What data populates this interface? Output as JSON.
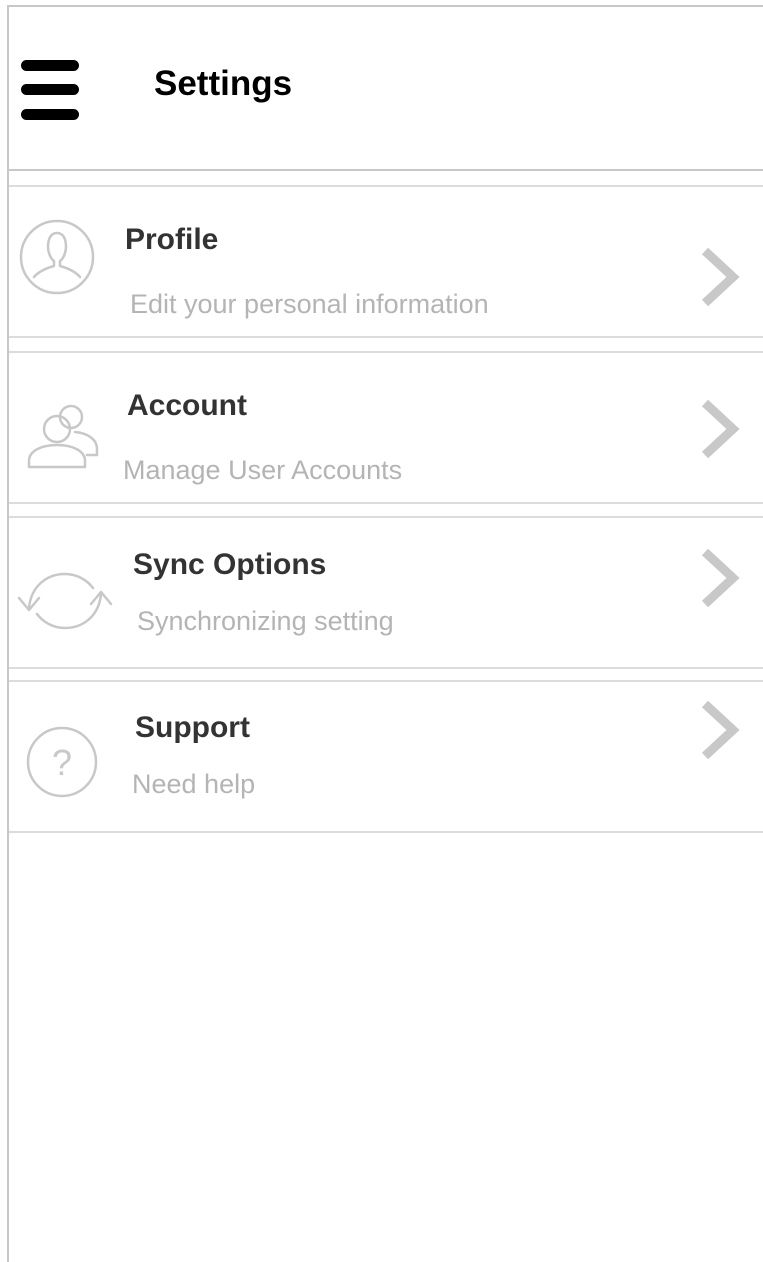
{
  "header": {
    "menu_icon": "hamburger-menu-icon",
    "title": "Settings"
  },
  "settings_items": [
    {
      "key": "profile",
      "icon": "user-circle-icon",
      "title": "Profile",
      "subtitle": "Edit your personal information"
    },
    {
      "key": "account",
      "icon": "users-icon",
      "title": "Account",
      "subtitle": "Manage User Accounts"
    },
    {
      "key": "sync",
      "icon": "sync-icon",
      "title": "Sync Options",
      "subtitle": "Synchronizing setting"
    },
    {
      "key": "support",
      "icon": "help-circle-icon",
      "title": "Support",
      "subtitle": "Need help"
    }
  ],
  "colors": {
    "title": "#000000",
    "item_title": "#333333",
    "item_subtitle": "#b4b4b4",
    "icon": "#c8c8c8",
    "divider": "#dcdcdc"
  }
}
